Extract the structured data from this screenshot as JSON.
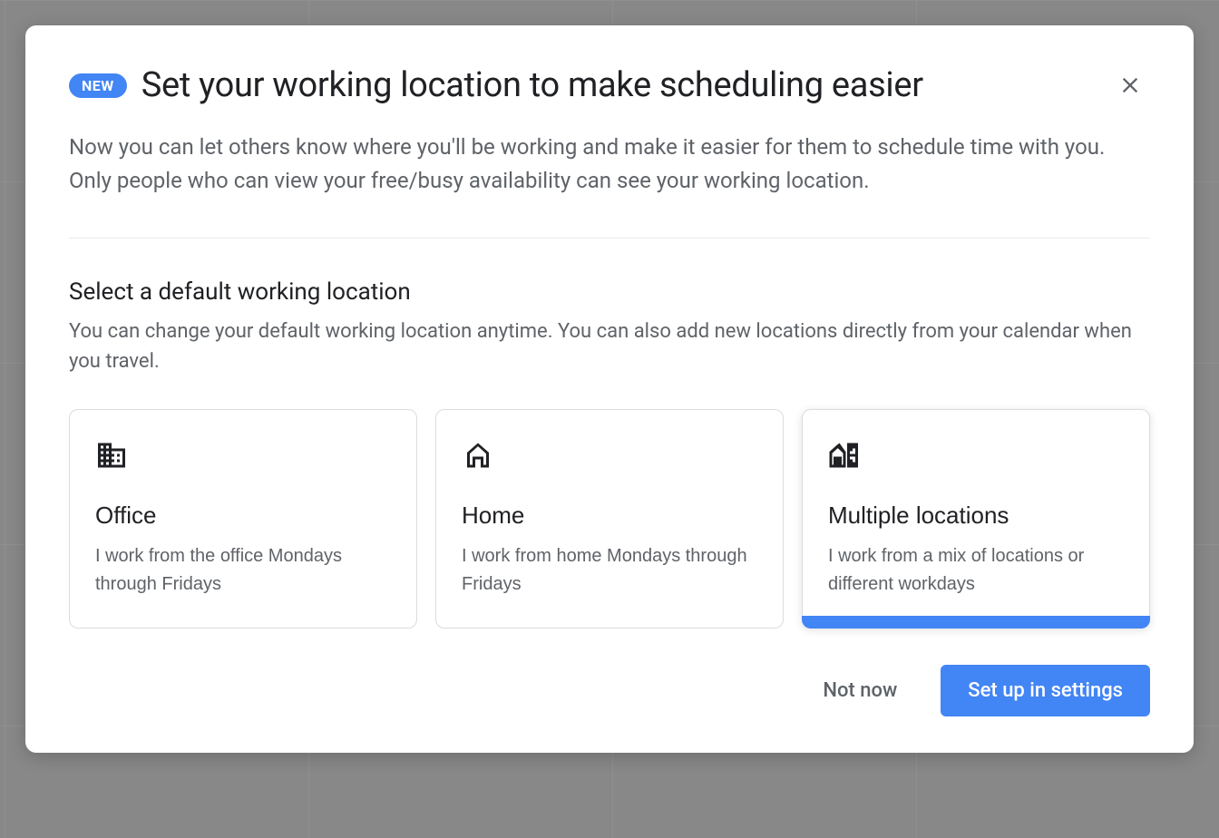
{
  "modal": {
    "badge": "NEW",
    "title": "Set your working location to make scheduling easier",
    "description": "Now you can let others know where you'll be working and make it easier for them to schedule time with you. Only people who can view your free/busy availability can see your working location.",
    "section": {
      "title": "Select a default working location",
      "description": "You can change your default working location anytime. You can also add new locations directly from your calendar when you travel."
    },
    "cards": {
      "office": {
        "title": "Office",
        "description": "I work from the office Mondays through Fridays"
      },
      "home": {
        "title": "Home",
        "description": "I work from home Mondays through Fridays"
      },
      "multiple": {
        "title": "Multiple locations",
        "description": "I work from a mix of locations or different workdays"
      }
    },
    "selected_card": "multiple",
    "footer": {
      "not_now": "Not now",
      "set_up": "Set up in settings"
    }
  }
}
